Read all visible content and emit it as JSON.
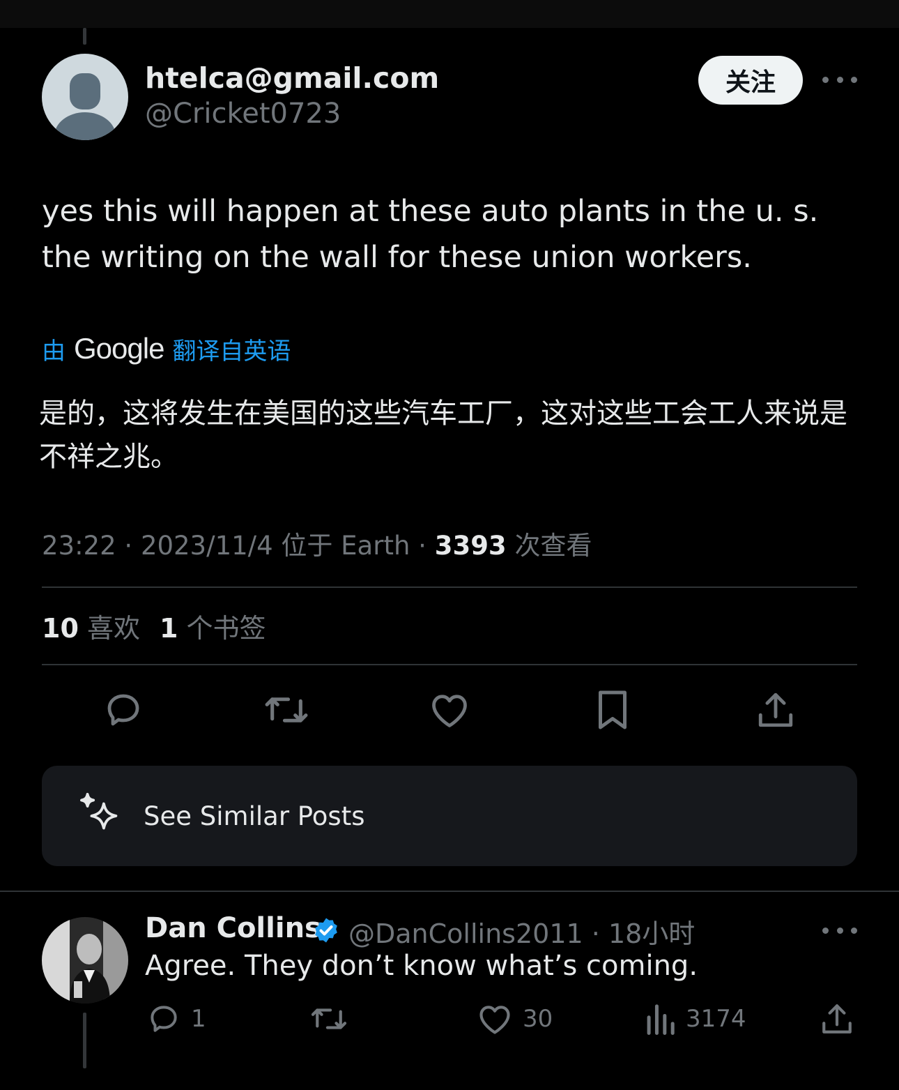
{
  "post": {
    "author_name": "htelca@gmail.com",
    "author_handle": "@Cricket0723",
    "follow_label": "关注",
    "text": "yes this will happen at these auto plants in the u. s. the writing on the wall for these union workers.",
    "translation": {
      "prefix": "由",
      "brand": "Google",
      "suffix": "翻译自英语",
      "text": "是的，这将发生在美国的这些汽车工厂，这对这些工会工人来说是不祥之兆。"
    },
    "meta": {
      "time": "23:22",
      "sep1": " · ",
      "date": "2023/11/4",
      "location": " 位于 Earth",
      "sep2": " · ",
      "views": "3393",
      "views_label": " 次查看"
    },
    "stats": {
      "likes_count": "10",
      "likes_label": " 喜欢",
      "bookmarks_count": "1",
      "bookmarks_label": " 个书签"
    },
    "actions": [
      "reply-icon",
      "repost-icon",
      "like-icon",
      "bookmark-icon",
      "share-icon"
    ],
    "similar_label": "See Similar Posts"
  },
  "reply": {
    "author_name": "Dan Collins",
    "author_handle": "@DanCollins2011",
    "separator": " · ",
    "time": "18小时",
    "text": "Agree. They don’t know what’s coming.",
    "reply_count": "1",
    "like_count": "30",
    "view_count": "3174"
  },
  "colors": {
    "background": "#000000",
    "text_primary": "#e7e9ea",
    "text_secondary": "#71767b",
    "link": "#1d9bf0",
    "verified": "#1d9bf0",
    "card": "#16181c",
    "divider": "#2f3336"
  }
}
